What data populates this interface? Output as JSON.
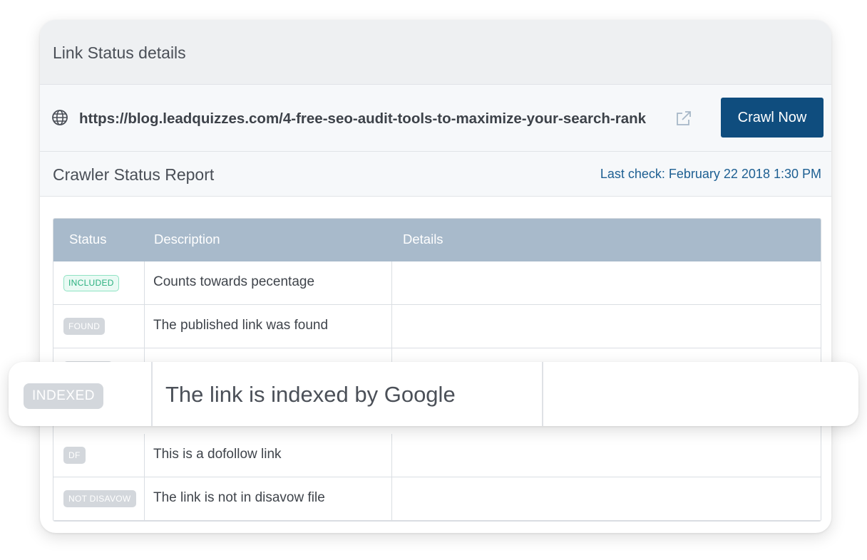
{
  "panel": {
    "title": "Link Status details"
  },
  "url_bar": {
    "url": "https://blog.leadquizzes.com/4-free-seo-audit-tools-to-maximize-your-search-rank",
    "icon": "globe-icon",
    "external_icon": "external-link-icon",
    "crawl_button_label": "Crawl Now",
    "button_color": "#0f4d7e"
  },
  "report": {
    "title": "Crawler Status Report",
    "last_check": "Last check: February 22 2018 1:30 PM"
  },
  "table": {
    "headers": [
      "Status",
      "Description",
      "Details"
    ],
    "rows": [
      {
        "status": "INCLUDED",
        "description": "Counts towards pecentage",
        "details": ""
      },
      {
        "status": "FOUND",
        "description": "The published link was found",
        "details": ""
      },
      {
        "status": "INDEXED",
        "description": "The link is indexed by Google",
        "details": ""
      },
      {
        "status": "DF",
        "description": "This is a dofollow link",
        "details": ""
      },
      {
        "status": "NOT DISAVOW",
        "description": "The link is not in disavow file",
        "details": ""
      }
    ]
  },
  "colors": {
    "header_bg": "#a8bacb",
    "included_text": "#2bb07f",
    "badge_gray": "#d3d7dc",
    "link_blue": "#1d5f92"
  }
}
